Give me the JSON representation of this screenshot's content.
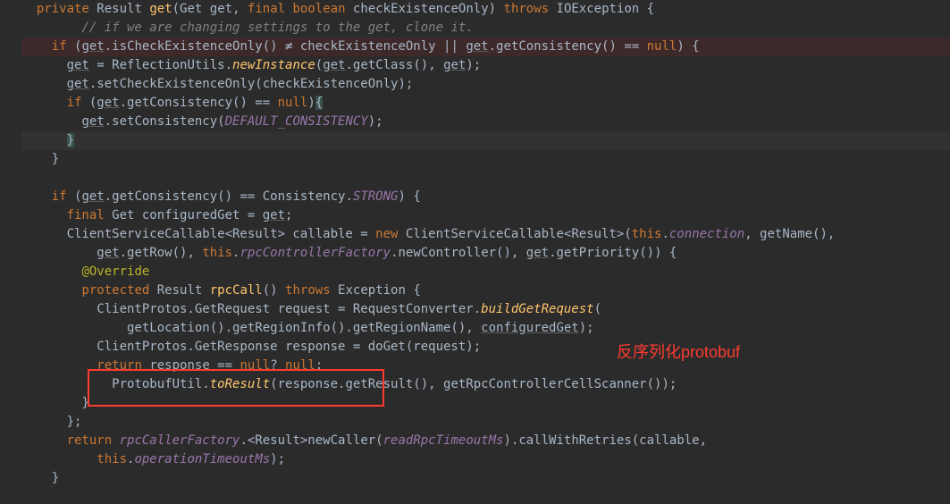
{
  "code": {
    "l1": "  private Result get(Get get, final boolean checkExistenceOnly) throws IOException {",
    "l2": "    // if we are changing settings to the get, clone it.",
    "l3": "    if (get.isCheckExistenceOnly() ≠ checkExistenceOnly || get.getConsistency() == null) {",
    "l4": "      get = ReflectionUtils.newInstance(get.getClass(), get);",
    "l5": "      get.setCheckExistenceOnly(checkExistenceOnly);",
    "l6": "      if (get.getConsistency() == null){",
    "l7": "        get.setConsistency(DEFAULT_CONSISTENCY);",
    "l8": "      }",
    "l9": "    }",
    "l10": "",
    "l11": "    if (get.getConsistency() == Consistency.STRONG) {",
    "l12": "      final Get configuredGet = get;",
    "l13": "      ClientServiceCallable<Result> callable = new ClientServiceCallable<Result>(this.connection, getName(),",
    "l14": "          get.getRow(), this.rpcControllerFactory.newController(), get.getPriority()) {",
    "l15": "        @Override",
    "l16": "        protected Result rpcCall() throws Exception {",
    "l17": "          ClientProtos.GetRequest request = RequestConverter.buildGetRequest(",
    "l18": "              getLocation().getRegionInfo().getRegionName(), configuredGet);",
    "l19": "          ClientProtos.GetResponse response = doGet(request);",
    "l20": "          return response == null? null:",
    "l21": "            ProtobufUtil.toResult(response.getResult(), getRpcControllerCellScanner());",
    "l22": "        }",
    "l23": "      };",
    "l24": "      return rpcCallerFactory.<Result>newCaller(readRpcTimeoutMs).callWithRetries(callable,",
    "l25": "          this.operationTimeoutMs);",
    "l26": "    }"
  },
  "annotation": "反序列化protobuf",
  "colors": {
    "keyword": "#cc7832",
    "method": "#ffc66d",
    "field": "#9876aa",
    "comment": "#808080",
    "annotation_red": "#ff3b30",
    "override": "#bbb529",
    "background": "#2b2b2b",
    "foreground": "#a9b7c6"
  },
  "highlight_box": {
    "target": "ProtobufUtil.toResult(response.getResult(),"
  }
}
